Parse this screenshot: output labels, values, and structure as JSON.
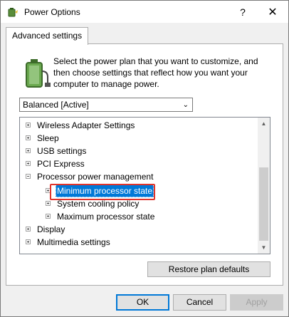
{
  "window": {
    "title": "Power Options",
    "help_glyph": "?",
    "close_glyph": "✕"
  },
  "tab": {
    "label": "Advanced settings"
  },
  "intro": {
    "text": "Select the power plan that you want to customize, and then choose settings that reflect how you want your computer to manage power."
  },
  "plan_select": {
    "value": "Balanced [Active]"
  },
  "tree": {
    "items": [
      {
        "label": "Wireless Adapter Settings"
      },
      {
        "label": "Sleep"
      },
      {
        "label": "USB settings"
      },
      {
        "label": "PCI Express"
      },
      {
        "label": "Processor power management"
      },
      {
        "label": "Minimum processor state"
      },
      {
        "label": "System cooling policy"
      },
      {
        "label": "Maximum processor state"
      },
      {
        "label": "Display"
      },
      {
        "label": "Multimedia settings"
      }
    ]
  },
  "buttons": {
    "restore_label": "Restore plan defaults",
    "ok_label": "OK",
    "cancel_label": "Cancel",
    "apply_label": "Apply"
  },
  "colors": {
    "selection": "#0078d7",
    "highlight_border": "#e0342b"
  }
}
